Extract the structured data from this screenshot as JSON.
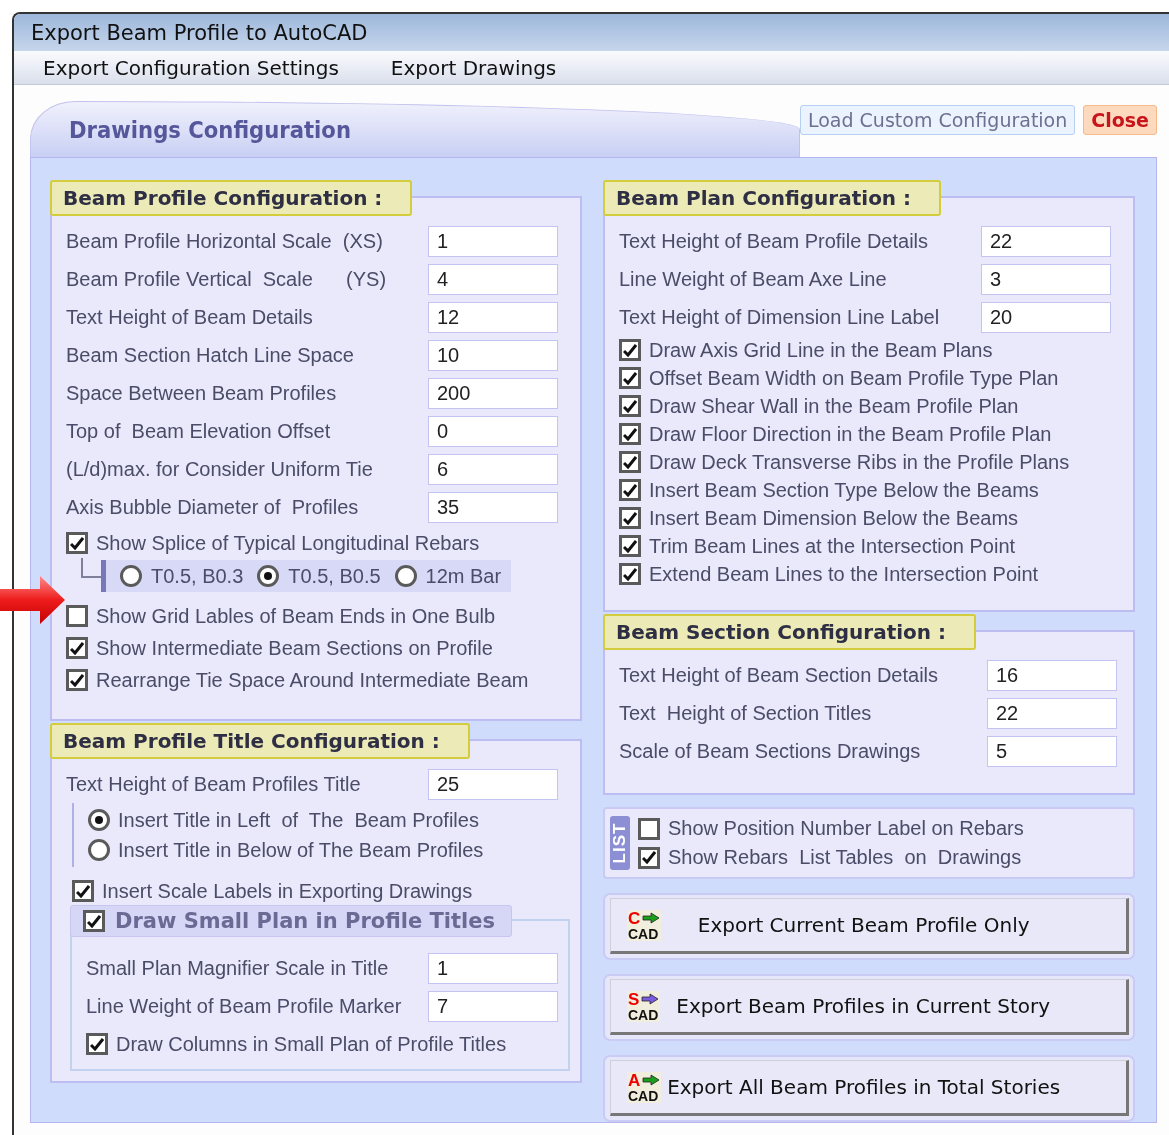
{
  "window": {
    "title": "Export Beam Profile to AutoCAD"
  },
  "menu": [
    {
      "label": "Export Configuration Settings"
    },
    {
      "label": "Export Drawings"
    }
  ],
  "page_tab": {
    "title": "Drawings Configuration"
  },
  "top_buttons": [
    {
      "label": "Load Custom Configuration",
      "kind": "normal"
    },
    {
      "label": "Close",
      "kind": "danger"
    }
  ],
  "beam_profile": {
    "title": "Beam Profile Configuration :",
    "fields": [
      {
        "label": "Beam Profile Horizontal Scale  (XS)",
        "value": "1"
      },
      {
        "label": "Beam Profile Vertical  Scale      (YS)",
        "value": "4"
      },
      {
        "label": "Text Height of Beam Details",
        "value": "12"
      },
      {
        "label": "Beam Section Hatch Line Space",
        "value": "10"
      },
      {
        "label": "Space Between Beam Profiles",
        "value": "200"
      },
      {
        "label": "Top of  Beam Elevation Offset",
        "value": "0"
      },
      {
        "label": "(L/d)max. for Consider Uniform Tie",
        "value": "6"
      },
      {
        "label": "Axis Bubble Diameter of  Profiles",
        "value": "35"
      }
    ],
    "splice": {
      "label": "Show Splice of Typical Longitudinal Rebars",
      "checked": true,
      "options": [
        {
          "label": "T0.5, B0.3",
          "selected": false
        },
        {
          "label": "T0.5, B0.5",
          "selected": true
        },
        {
          "label": "12m Bar",
          "selected": false
        }
      ]
    },
    "checks": [
      {
        "label": "Show Grid Lables of Beam Ends in One Bulb",
        "checked": false
      },
      {
        "label": "Show Intermediate Beam Sections on Profile",
        "checked": true
      },
      {
        "label": "Rearrange Tie Space Around Intermediate Beam",
        "checked": true
      }
    ]
  },
  "profile_title": {
    "title": "Beam Profile Title Configuration :",
    "field": {
      "label": "Text Height of Beam Profiles Title",
      "value": "25"
    },
    "positions": [
      {
        "label": "Insert Title in Left  of  The  Beam Profiles",
        "selected": true
      },
      {
        "label": "Insert Title in Below of The Beam Profiles",
        "selected": false
      }
    ],
    "scale_labels": {
      "label": "Insert Scale Labels in Exporting Drawings",
      "checked": true
    },
    "small_plan": {
      "label": "Draw Small Plan in Profile Titles",
      "checked": true,
      "fields": [
        {
          "label": "Small Plan Magnifier Scale in Title",
          "value": "1"
        },
        {
          "label": "Line Weight of Beam Profile Marker",
          "value": "7"
        }
      ],
      "check": {
        "label": "Draw Columns in Small Plan of Profile Titles",
        "checked": true
      }
    }
  },
  "beam_plan": {
    "title": "Beam Plan Configuration :",
    "fields": [
      {
        "label": "Text Height of Beam Profile Details",
        "value": "22"
      },
      {
        "label": "Line Weight of Beam Axe Line",
        "value": "3"
      },
      {
        "label": "Text Height of Dimension Line Label",
        "value": "20"
      }
    ],
    "checks": [
      {
        "label": "Draw Axis Grid Line in the Beam Plans",
        "checked": true
      },
      {
        "label": "Offset Beam Width on Beam Profile Type Plan",
        "checked": true
      },
      {
        "label": "Draw Shear Wall in the Beam Profile Plan",
        "checked": true
      },
      {
        "label": "Draw Floor Direction in the Beam Profile Plan",
        "checked": true
      },
      {
        "label": "Draw Deck Transverse Ribs in the Profile Plans",
        "checked": true
      },
      {
        "label": "Insert Beam Section Type Below the Beams",
        "checked": true
      },
      {
        "label": "Insert Beam Dimension Below the Beams",
        "checked": true
      },
      {
        "label": "Trim Beam Lines at the Intersection Point",
        "checked": true
      },
      {
        "label": "Extend Beam Lines to the Intersection Point",
        "checked": true
      }
    ]
  },
  "beam_section": {
    "title": "Beam Section Configuration :",
    "fields": [
      {
        "label": "Text Height of Beam Section Details",
        "value": "16"
      },
      {
        "label": "Text  Height of Section Titles",
        "value": "22"
      },
      {
        "label": "Scale of Beam Sections Drawings",
        "value": "5"
      }
    ]
  },
  "list_options": {
    "tag": "LIST",
    "checks": [
      {
        "label": "Show Position Number Label on Rebars",
        "checked": false
      },
      {
        "label": "Show Rebars  List Tables  on  Drawings",
        "checked": true
      }
    ]
  },
  "export_buttons": [
    {
      "letter": "C",
      "cad": "CAD",
      "color": "#1aa01a",
      "label": "Export Current Beam Profile Only"
    },
    {
      "letter": "S",
      "cad": "CAD",
      "color": "#7b5ce0",
      "label": "Export Beam Profiles in Current Story"
    },
    {
      "letter": "A",
      "cad": "CAD",
      "color": "#1aa01a",
      "label": "Export All Beam Profiles in Total Stories"
    }
  ]
}
